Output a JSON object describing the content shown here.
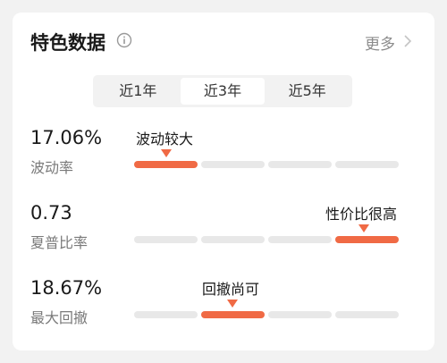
{
  "header": {
    "title": "特色数据",
    "info_icon": "info-circle-icon",
    "more_label": "更多",
    "more_icon": "chevron-right-icon"
  },
  "tabs": [
    {
      "label": "近1年",
      "active": false
    },
    {
      "label": "近3年",
      "active": true
    },
    {
      "label": "近5年",
      "active": false
    }
  ],
  "metrics": [
    {
      "value": "17.06%",
      "label": "波动率",
      "tag": "波动较大",
      "level_segment": 1,
      "segments": 4
    },
    {
      "value": "0.73",
      "label": "夏普比率",
      "tag": "性价比很高",
      "level_segment": 4,
      "segments": 4
    },
    {
      "value": "18.67%",
      "label": "最大回撤",
      "tag": "回撤尚可",
      "level_segment": 2,
      "segments": 4
    }
  ],
  "colors": {
    "accent": "#f06a45",
    "track": "#e8e8e8"
  }
}
